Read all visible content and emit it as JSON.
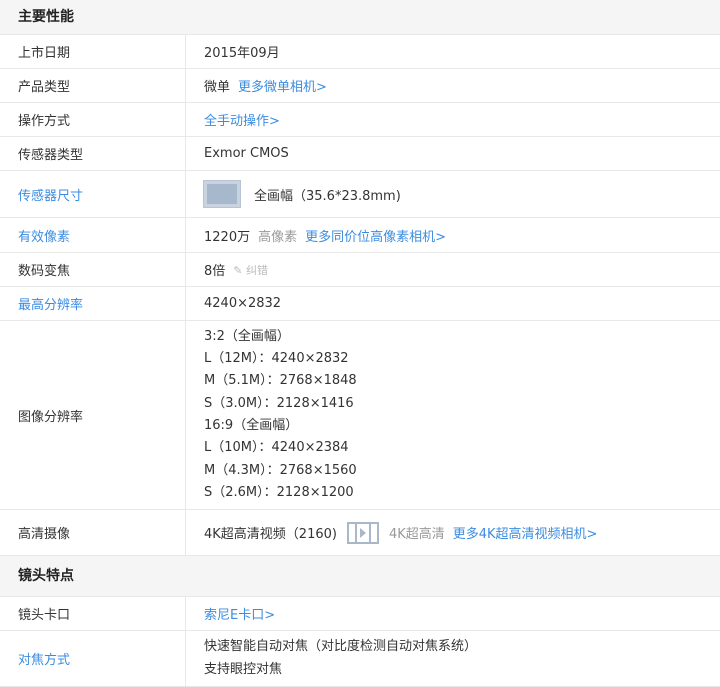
{
  "sections": [
    {
      "title": "主要性能"
    },
    {
      "title": "镜头特点"
    }
  ],
  "rows": {
    "release": {
      "label": "上市日期",
      "value": "2015年09月"
    },
    "type": {
      "label": "产品类型",
      "value": "微单",
      "link": "更多微单相机>"
    },
    "operation": {
      "label": "操作方式",
      "link": "全手动操作>"
    },
    "sensor_type": {
      "label": "传感器类型",
      "value": "Exmor CMOS"
    },
    "sensor_size": {
      "label": "传感器尺寸",
      "value": "全画幅（35.6*23.8mm)"
    },
    "pixels": {
      "label": "有效像素",
      "value": "1220万",
      "tag": "高像素",
      "link": "更多同价位高像素相机>"
    },
    "zoom": {
      "label": "数码变焦",
      "value": "8倍",
      "correction": "纠错"
    },
    "max_res": {
      "label": "最高分辨率",
      "value": "4240×2832"
    },
    "image_res": {
      "label": "图像分辨率",
      "lines": [
        "3:2（全画幅）",
        "L（12M）：4240×2832",
        "M（5.1M）：2768×1848",
        "S（3.0M）：2128×1416",
        "16:9（全画幅）",
        "L（10M）：4240×2384",
        "M（4.3M）：2768×1560",
        "S（2.6M）：2128×1200"
      ]
    },
    "hd_video": {
      "label": "高清摄像",
      "value": "4K超高清视频（2160)",
      "tag": "4K超高清",
      "link": "更多4K超高清视频相机>"
    },
    "mount": {
      "label": "镜头卡口",
      "link": "索尼E卡口>"
    },
    "focus": {
      "label": "对焦方式",
      "lines": [
        "快速智能自动对焦（对比度检测自动对焦系统）",
        "支持眼控对焦"
      ]
    }
  }
}
